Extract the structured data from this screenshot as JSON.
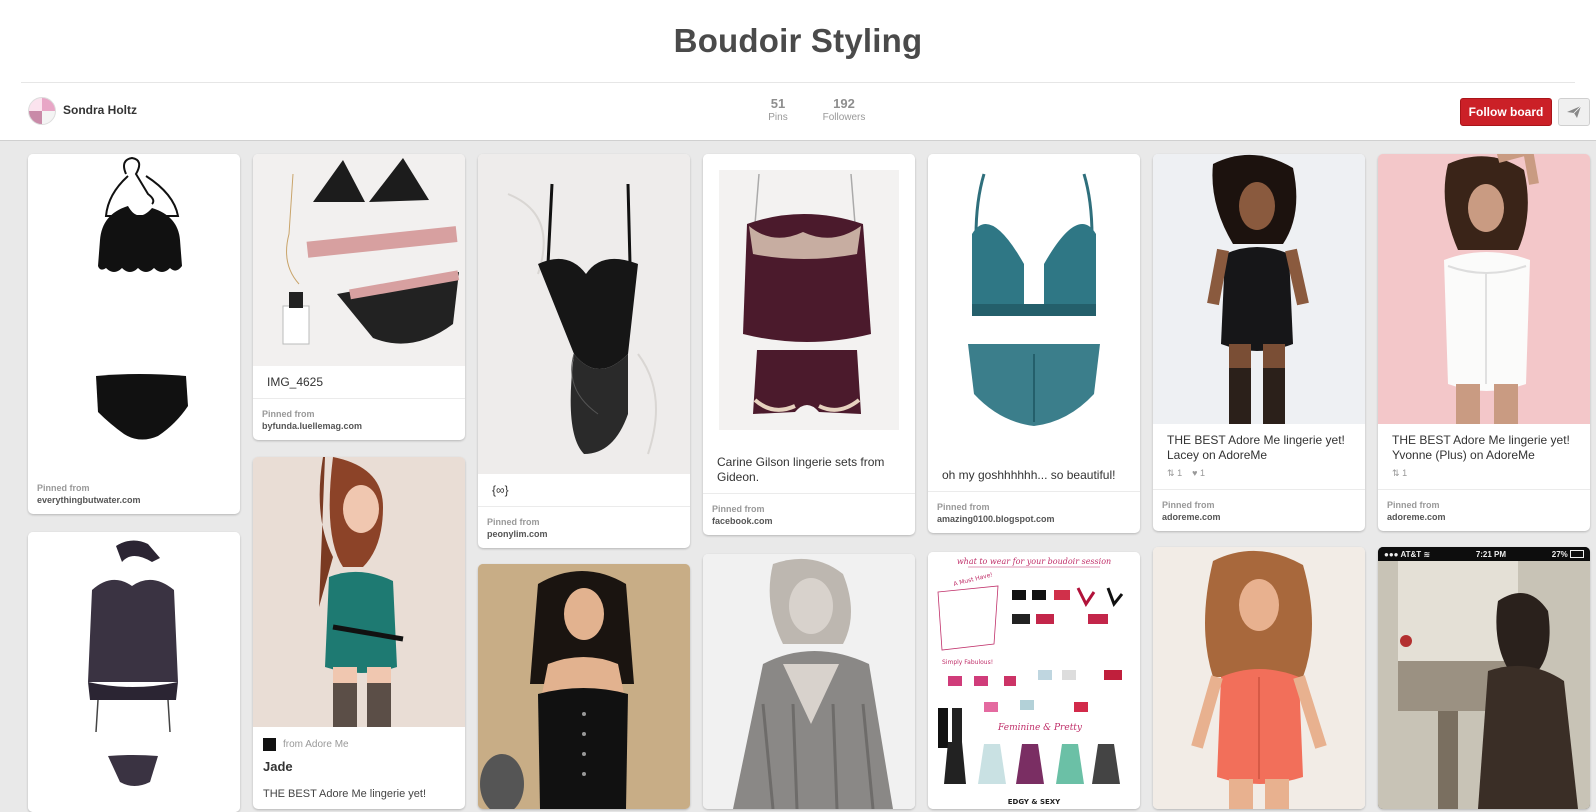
{
  "board": {
    "title": "Boudoir Styling",
    "owner": "Sondra Holtz",
    "pins_count": "51",
    "pins_label": "Pins",
    "followers_count": "192",
    "followers_label": "Followers",
    "follow_label": "Follow board"
  },
  "pins": [
    {
      "pinned_from_label": "Pinned from",
      "source": "everythingbutwater.com"
    },
    {
      "caption": "IMG_4625",
      "pinned_from_label": "Pinned from",
      "source": "byfunda.luellemag.com"
    },
    {
      "caption": "{∞}",
      "pinned_from_label": "Pinned from",
      "source": "peonylim.com"
    },
    {
      "caption": "Carine Gilson lingerie sets from Gideon.",
      "pinned_from_label": "Pinned from",
      "source": "facebook.com"
    },
    {
      "caption": "oh my goshhhhhh... so beautiful!",
      "pinned_from_label": "Pinned from",
      "source": "amazing0100.blogspot.com"
    },
    {
      "caption": "THE BEST Adore Me lingerie yet! Lacey on AdoreMe",
      "repins": "1",
      "likes": "1",
      "pinned_from_label": "Pinned from",
      "source": "adoreme.com"
    },
    {
      "caption": "THE BEST Adore Me lingerie yet! Yvonne (Plus) on AdoreMe",
      "repins": "1",
      "pinned_from_label": "Pinned from",
      "source": "adoreme.com"
    },
    {},
    {
      "vendor": "from Adore Me",
      "title": "Jade",
      "caption_partial": "THE BEST Adore Me lingerie yet!"
    },
    {},
    {},
    {
      "infographic_heading": "what to wear for your boudoir session",
      "infographic_note1": "A Must Have!",
      "infographic_note2": "Simply Fabulous!",
      "infographic_note3": "Feminine & Pretty",
      "infographic_note4": "EDGY & SEXY"
    },
    {},
    {
      "carrier": "AT&T",
      "time": "7:21 PM",
      "battery": "27%"
    }
  ],
  "colors": {
    "background": "#e9e9e9",
    "follow_button": "#cb2027",
    "title_text": "#4a4a4a"
  },
  "icons": [
    "send-icon",
    "repin-icon",
    "like-icon",
    "wifi-icon",
    "battery-icon"
  ]
}
